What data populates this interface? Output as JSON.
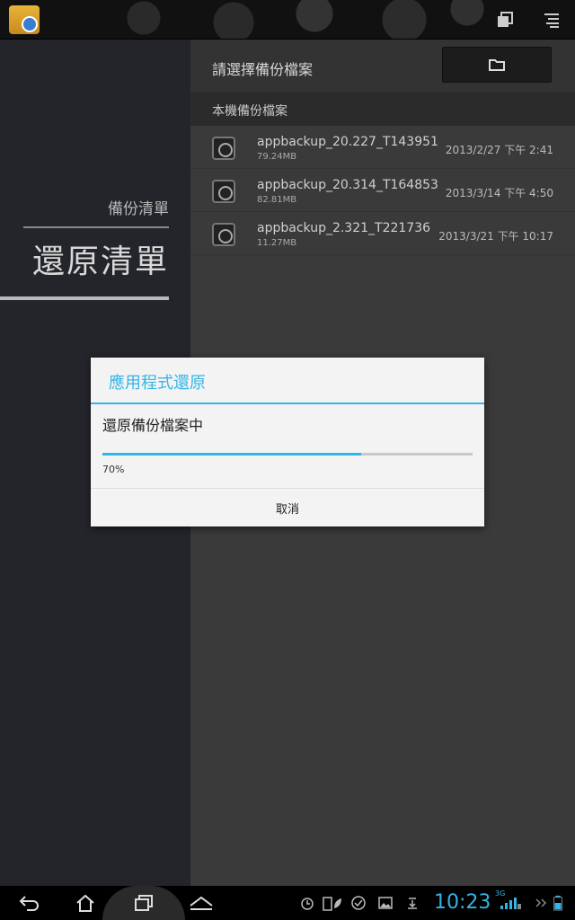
{
  "left_menu": {
    "backup_list": "備份清單",
    "restore_list": "還原清單"
  },
  "right_panel": {
    "header_title": "請選擇備份檔案",
    "section_label": "本機備份檔案",
    "files": [
      {
        "name": "appbackup_20.227_T143951",
        "size": "79.24MB",
        "date": "2013/2/27 下午 2:41"
      },
      {
        "name": "appbackup_20.314_T164853",
        "size": "82.81MB",
        "date": "2013/3/14 下午 4:50"
      },
      {
        "name": "appbackup_2.321_T221736",
        "size": "11.27MB",
        "date": "2013/3/21 下午 10:17"
      }
    ]
  },
  "dialog": {
    "title": "應用程式還原",
    "message": "還原備份檔案中",
    "progress": 70,
    "percent_label": "70%",
    "cancel_label": "取消"
  },
  "status_bar": {
    "time": "10:23",
    "network": "3G"
  },
  "colors": {
    "accent": "#33b5e5"
  }
}
